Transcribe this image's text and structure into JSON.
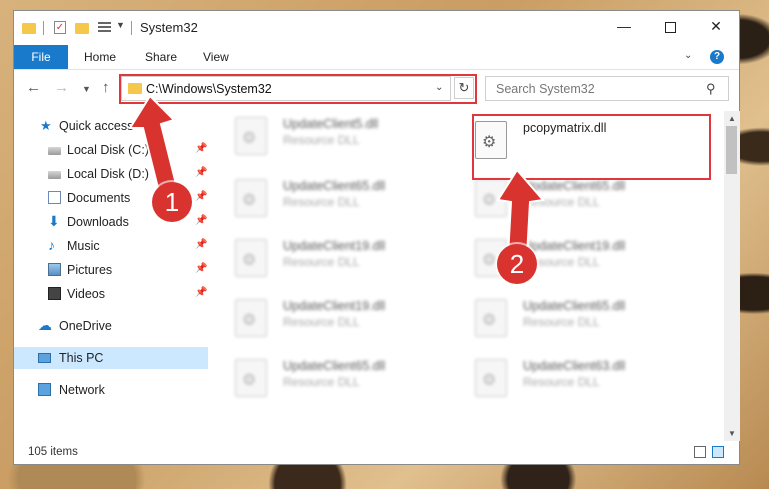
{
  "window": {
    "title": "System32",
    "controls": {
      "minimize": "—",
      "maximize": "",
      "close": "✕"
    }
  },
  "ribbon": {
    "tabs": [
      {
        "label": "File"
      },
      {
        "label": "Home"
      },
      {
        "label": "Share"
      },
      {
        "label": "View"
      }
    ],
    "help": "?"
  },
  "address_bar": {
    "path": "C:\\Windows\\System32",
    "refresh_icon": "refresh-icon"
  },
  "search": {
    "placeholder": "Search System32"
  },
  "nav_pane": {
    "items": [
      {
        "label": "Quick access",
        "icon": "star-icon"
      },
      {
        "label": "Local Disk (C:)",
        "icon": "disk-icon",
        "pinned": true
      },
      {
        "label": "Local Disk (D:)",
        "icon": "disk-icon",
        "pinned": true
      },
      {
        "label": "Documents",
        "icon": "documents-icon",
        "pinned": true
      },
      {
        "label": "Downloads",
        "icon": "download-icon",
        "pinned": true
      },
      {
        "label": "Music",
        "icon": "music-icon",
        "pinned": true
      },
      {
        "label": "Pictures",
        "icon": "pictures-icon",
        "pinned": true
      },
      {
        "label": "Videos",
        "icon": "videos-icon",
        "pinned": true
      },
      {
        "label": "OneDrive",
        "icon": "cloud-icon"
      },
      {
        "label": "This PC",
        "icon": "computer-icon",
        "selected": true
      },
      {
        "label": "Network",
        "icon": "network-icon"
      }
    ]
  },
  "files": {
    "left_column": [
      {
        "name": "UpdateClient5.dll",
        "type": "Resource DLL"
      },
      {
        "name": "UpdateClient65.dll",
        "type": "Resource DLL"
      },
      {
        "name": "UpdateClient19.dll",
        "type": "Resource DLL"
      },
      {
        "name": "UpdateClient19.dll",
        "type": "Resource DLL"
      },
      {
        "name": "UpdateClient65.dll",
        "type": "Resource DLL"
      }
    ],
    "right_column": [
      {
        "name": "pcopymatrix.dll",
        "type": ""
      },
      {
        "name": "UpdateClient65.dll",
        "type": "Resource DLL"
      },
      {
        "name": "UpdateClient19.dll",
        "type": "Resource DLL"
      },
      {
        "name": "UpdateClient65.dll",
        "type": "Resource DLL"
      },
      {
        "name": "UpdateClient63.dll",
        "type": "Resource DLL"
      }
    ]
  },
  "status_bar": {
    "item_count": "105 items"
  },
  "callouts": [
    {
      "number": "1"
    },
    {
      "number": "2"
    }
  ],
  "colors": {
    "accent": "#1979ca",
    "highlight": "#e0383a",
    "selected_bg": "#cce8ff"
  }
}
